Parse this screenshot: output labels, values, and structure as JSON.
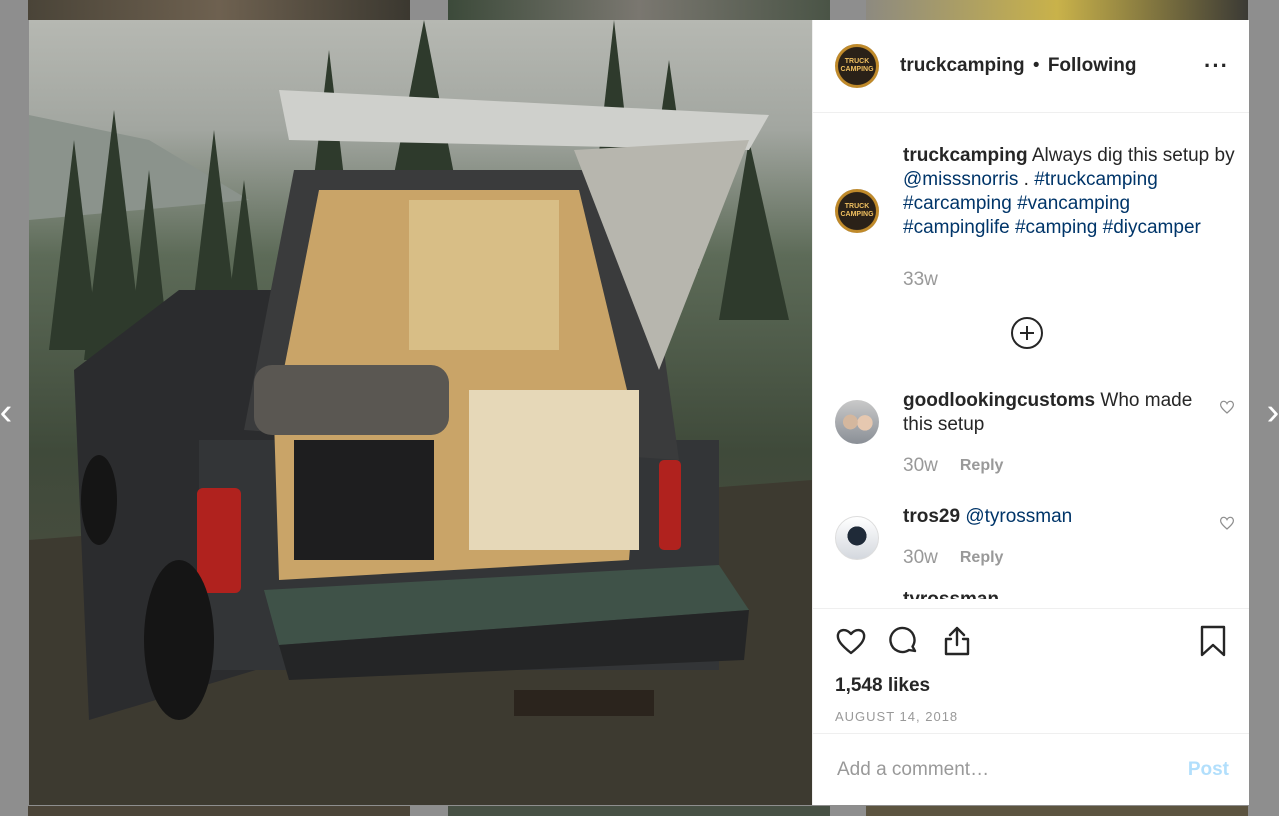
{
  "post": {
    "username": "truckcamping",
    "follow_separator": "•",
    "follow_state": "Following",
    "avatar_text_line1": "TRUCK",
    "avatar_text_line2": "CAMPING",
    "more_icon": "···",
    "caption": {
      "username": "truckcamping",
      "text_plain": "Always dig this setup by",
      "mention": "@misssnorris",
      "after_mention": " . ",
      "hashtags": [
        "#truckcamping",
        "#carcamping",
        "#vancamping",
        "#campinglife",
        "#camping",
        "#diycamper"
      ],
      "time": "33w"
    },
    "comments": [
      {
        "username": "goodlookingcustoms",
        "text": "Who made this setup",
        "time": "30w",
        "reply_label": "Reply"
      },
      {
        "username": "tros29",
        "text": "@tyrossman",
        "time": "30w",
        "reply_label": "Reply"
      }
    ],
    "partial_next_comment": "tyrossman",
    "likes": "1,548 likes",
    "date": "AUGUST 14, 2018",
    "comment_placeholder": "Add a comment…",
    "post_label": "Post"
  },
  "nav": {
    "prev": "‹",
    "next": "›"
  },
  "colors": {
    "link": "#003569",
    "muted": "#999999",
    "post_disabled": "#b2dffc",
    "text": "#262626"
  },
  "icons": [
    "heart-icon",
    "comment-icon",
    "share-icon",
    "bookmark-icon",
    "more-icon",
    "add-circle-icon",
    "small-heart-icon"
  ]
}
